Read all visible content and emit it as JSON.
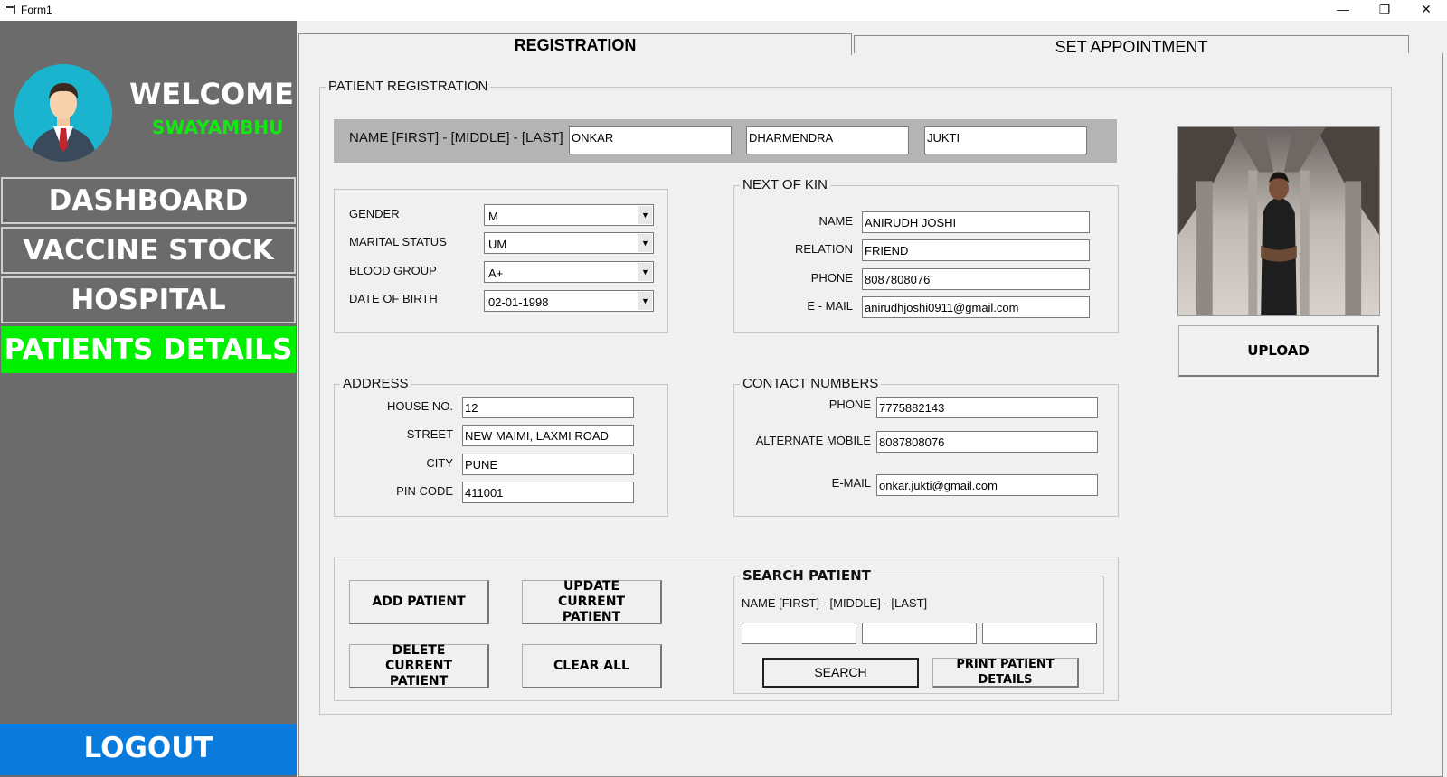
{
  "window": {
    "title": "Form1",
    "minimize": "—",
    "maximize": "❐",
    "close": "✕"
  },
  "sidebar": {
    "welcome": "WELCOME",
    "username": "SWAYAMBHU",
    "nav": [
      {
        "label": "DASHBOARD"
      },
      {
        "label": "VACCINE STOCK"
      },
      {
        "label": "HOSPITAL"
      },
      {
        "label": "PATIENTS DETAILS"
      }
    ],
    "logout": "LOGOUT"
  },
  "tabs": [
    {
      "label": "REGISTRATION",
      "selected": true
    },
    {
      "label": "SET APPOINTMENT",
      "selected": false
    }
  ],
  "registration": {
    "group_title": "PATIENT REGISTRATION",
    "name_label": "NAME [FIRST] - [MIDDLE] - [LAST]",
    "first": "ONKAR",
    "middle": "DHARMENDRA",
    "last": "JUKTI",
    "personal": {
      "gender_label": "GENDER",
      "gender": "M",
      "marital_label": "MARITAL STATUS",
      "marital": "UM",
      "blood_label": "BLOOD GROUP",
      "blood": "A+",
      "dob_label": "DATE OF BIRTH",
      "dob": "02-01-1998"
    },
    "kin": {
      "title": "NEXT OF KIN",
      "name_label": "NAME",
      "name": "ANIRUDH JOSHI",
      "relation_label": "RELATION",
      "relation": "FRIEND",
      "phone_label": "PHONE",
      "phone": "8087808076",
      "email_label": "E - MAIL",
      "email": "anirudhjoshi0911@gmail.com"
    },
    "address": {
      "title": "ADDRESS",
      "house_label": "HOUSE NO.",
      "house": "12",
      "street_label": "STREET",
      "street": "NEW MAIMI, LAXMI ROAD",
      "city_label": "CITY",
      "city": "PUNE",
      "pin_label": "PIN CODE",
      "pin": "411001"
    },
    "contact": {
      "title": "CONTACT NUMBERS",
      "phone_label": "PHONE",
      "phone": "7775882143",
      "alt_label": "ALTERNATE MOBILE",
      "alt": "8087808076",
      "email_label": "E-MAIL",
      "email": "onkar.jukti@gmail.com"
    },
    "actions": {
      "add": "ADD PATIENT",
      "update": "UPDATE CURRENT PATIENT",
      "delete": "DELETE CURRENT PATIENT",
      "clear": "CLEAR ALL"
    },
    "search": {
      "title": "SEARCH PATIENT",
      "name_label": "NAME [FIRST] - [MIDDLE] - [LAST]",
      "first": "",
      "middle": "",
      "last": "",
      "search_btn": "SEARCH",
      "print_btn": "PRINT PATIENT DETAILS"
    },
    "upload": "UPLOAD"
  },
  "colors": {
    "sidebar": "#6b6b6b",
    "active_nav": "#00f000",
    "logout": "#0a7bdc",
    "username": "#13e813"
  }
}
